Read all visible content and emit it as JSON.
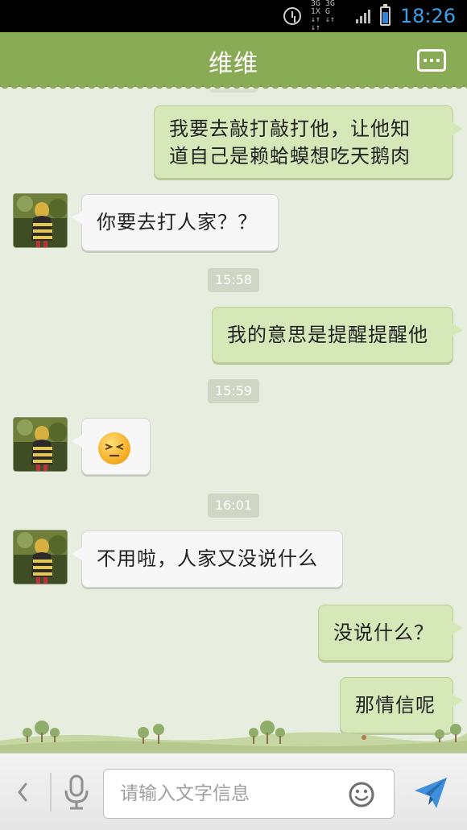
{
  "status_bar": {
    "network_top": "3G 3G 1X G",
    "network_bottom": "↓↑ ↓↑ ↓↑",
    "time": "18:26",
    "battery_level": 0.7,
    "signal_bars": 4
  },
  "header": {
    "title": "维维",
    "menu_icon": "more-dots-icon"
  },
  "messages": [
    {
      "type": "text",
      "from": "me",
      "text_lines": [
        "我要去敲打敲打他，让他知",
        "道自己是赖蛤蟆想吃天鹅肉"
      ]
    },
    {
      "type": "text",
      "from": "other",
      "text_lines": [
        "你要去打人家？？"
      ]
    },
    {
      "type": "time",
      "text": "15:58"
    },
    {
      "type": "text",
      "from": "me",
      "text_lines": [
        "我的意思是提醒提醒他"
      ]
    },
    {
      "type": "time",
      "text": "15:59"
    },
    {
      "type": "emoji",
      "from": "other",
      "emoji": "squinting-face-emoji"
    },
    {
      "type": "time",
      "text": "16:01"
    },
    {
      "type": "text",
      "from": "other",
      "text_lines": [
        "不用啦，人家又没说什么"
      ]
    },
    {
      "type": "text",
      "from": "me",
      "text_lines": [
        "没说什么？"
      ]
    },
    {
      "type": "text",
      "from": "me",
      "text_lines": [
        "那情信呢"
      ]
    }
  ],
  "input_bar": {
    "placeholder": "请输入文字信息",
    "value": "",
    "icons": [
      "back-chevron-icon",
      "microphone-icon",
      "smiley-icon",
      "send-icon"
    ]
  },
  "colors": {
    "header_bg": "#8aab55",
    "chat_bg": "#e8eedf",
    "my_bubble": "#d6e7b8",
    "their_bubble": "#f7f7f7",
    "timestamp_bg": "#cfd7c4",
    "clock_blue": "#3aa0e8"
  }
}
